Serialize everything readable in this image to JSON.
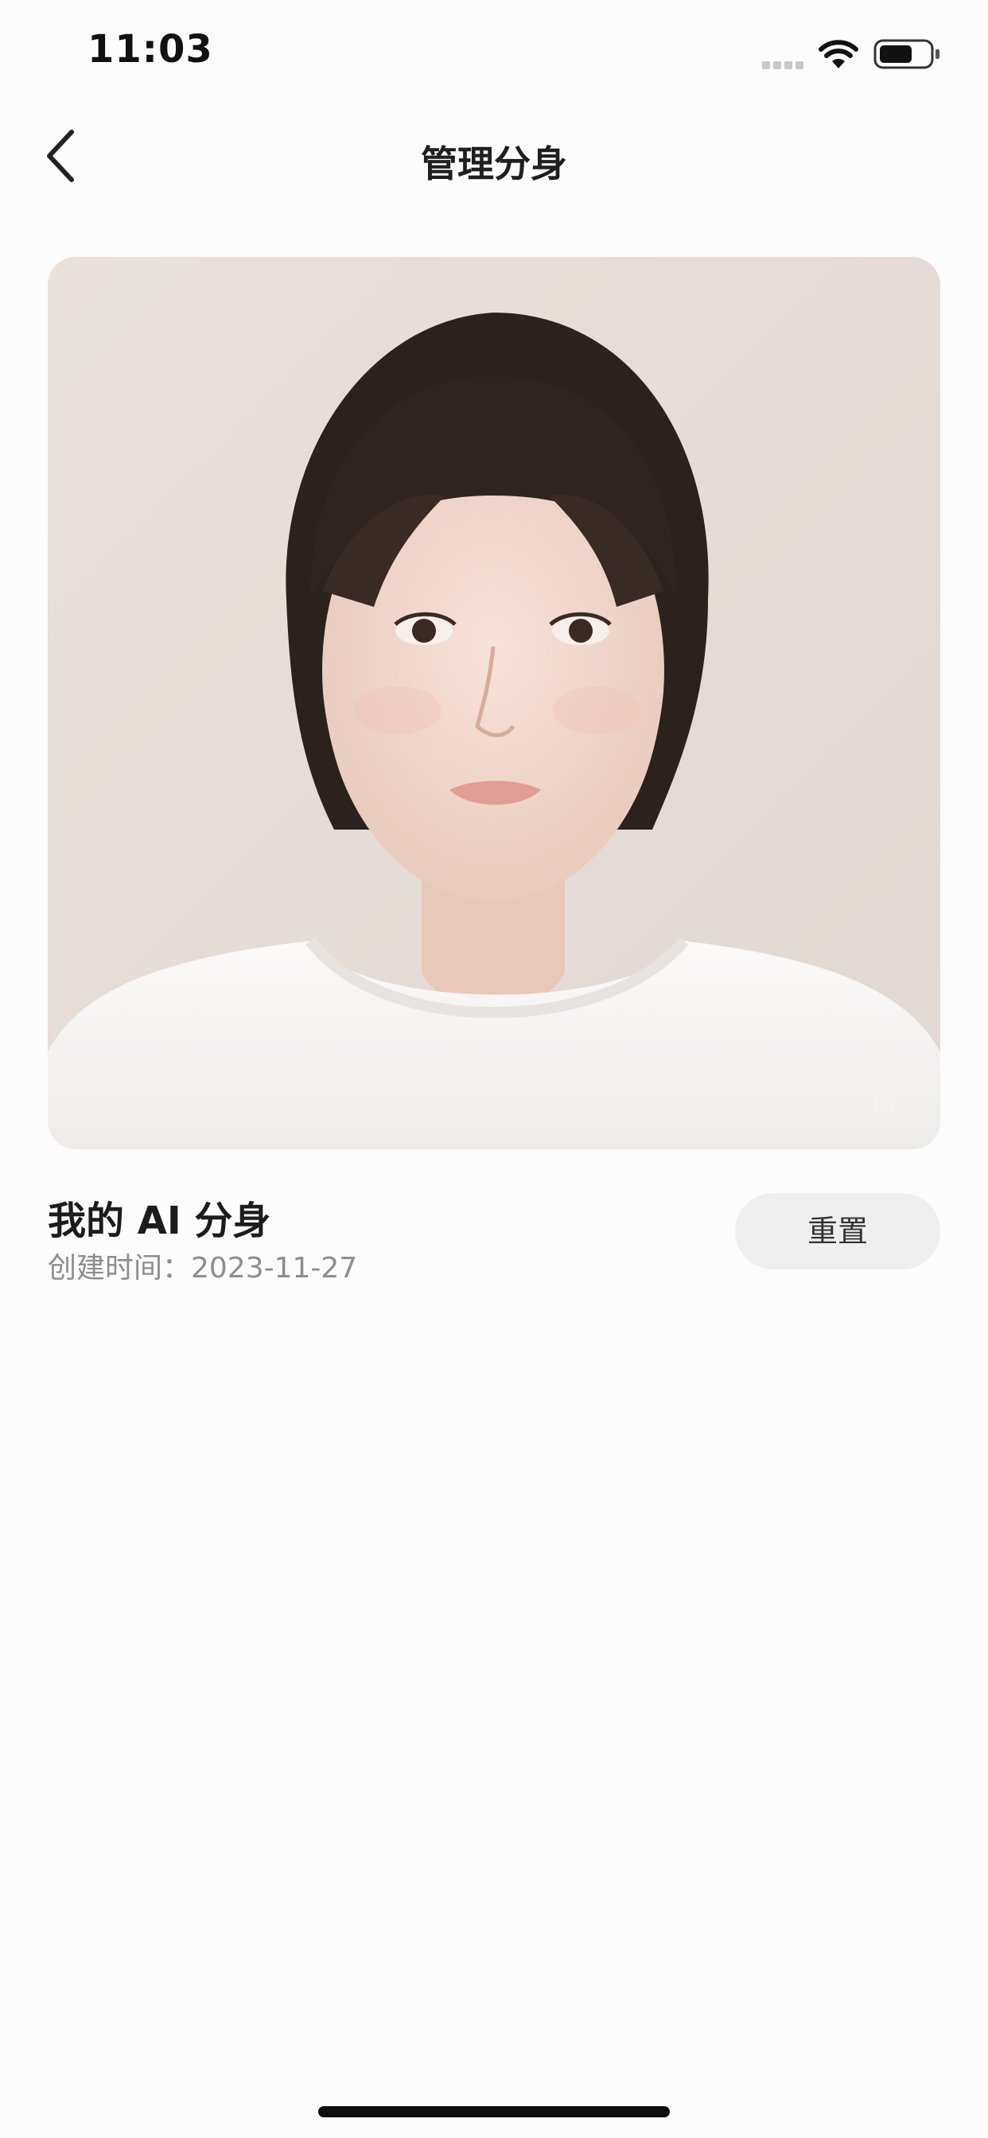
{
  "status_bar": {
    "time": "11:03"
  },
  "nav": {
    "back_icon": "chevron-left-icon",
    "title": "管理分身"
  },
  "avatar_card": {
    "delete_icon": "trash-icon"
  },
  "clone": {
    "name": "我的 AI 分身",
    "created_label": "创建时间：2023-11-27"
  },
  "actions": {
    "reset_label": "重置"
  },
  "colors": {
    "background": "#fdfcfc",
    "button_bg": "#efefef",
    "secondary_text": "#8d8d8d"
  }
}
